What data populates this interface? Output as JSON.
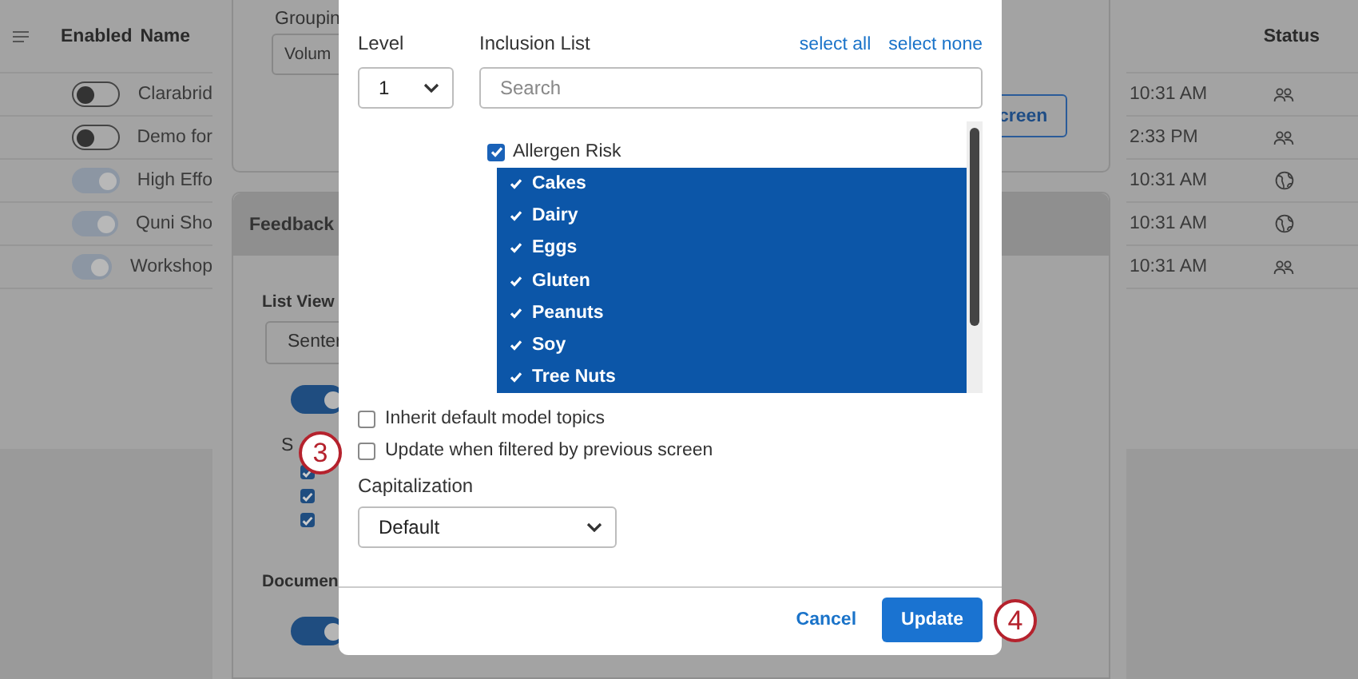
{
  "background": {
    "table": {
      "columns": [
        "Enabled",
        "Name"
      ],
      "rows": [
        {
          "on": false,
          "name": "Clarabrid"
        },
        {
          "on": false,
          "name": "Demo for"
        },
        {
          "on": true,
          "name": "High Effo"
        },
        {
          "on": true,
          "name": "Quni Sho"
        },
        {
          "on": true,
          "name": "Workshop"
        }
      ]
    },
    "grouping_card": {
      "label": "Groupin",
      "select": "Volum",
      "button": "creen"
    },
    "feedback_card": {
      "title": "Feedback",
      "list_view_label": "List View",
      "list_view_select": "Senter",
      "list_view_toggle_on": true,
      "section_label": "S",
      "checkboxes": [
        {
          "checked": true
        },
        {
          "checked": true
        },
        {
          "checked": true
        }
      ],
      "document_label": "Documen",
      "document_toggle_on": true
    },
    "status_table": {
      "columns": [
        "Status"
      ],
      "rows": [
        {
          "time": "10:31 AM",
          "kind": "people"
        },
        {
          "time": "2:33 PM",
          "kind": "people"
        },
        {
          "time": "10:31 AM",
          "kind": "globe"
        },
        {
          "time": "10:31 AM",
          "kind": "globe"
        },
        {
          "time": "10:31 AM",
          "kind": "people"
        }
      ]
    }
  },
  "dialog": {
    "level_label": "Level",
    "level_value": "1",
    "inclusion_label": "Inclusion List",
    "select_all": "select all",
    "select_none": "select none",
    "search": {
      "placeholder": "Search"
    },
    "tree": [
      {
        "label": "Allergen Risk",
        "checked": true,
        "selected": false,
        "children": [
          {
            "label": "Cakes",
            "checked": true,
            "selected": true
          },
          {
            "label": "Dairy",
            "checked": true,
            "selected": true
          },
          {
            "label": "Eggs",
            "checked": true,
            "selected": true
          },
          {
            "label": "Gluten",
            "checked": true,
            "selected": true
          },
          {
            "label": "Peanuts",
            "checked": true,
            "selected": true
          },
          {
            "label": "Soy",
            "checked": true,
            "selected": true
          },
          {
            "label": "Tree Nuts",
            "checked": true,
            "selected": true
          }
        ]
      }
    ],
    "options": [
      {
        "label": "Inherit default model topics",
        "checked": false
      },
      {
        "label": "Update when filtered by previous screen",
        "checked": false
      }
    ],
    "capitalization_label": "Capitalization",
    "capitalization_value": "Default",
    "buttons": [
      {
        "label": "Cancel",
        "kind": "link"
      },
      {
        "label": "Update",
        "kind": "primary"
      }
    ]
  },
  "callouts": [
    "3",
    "4"
  ]
}
